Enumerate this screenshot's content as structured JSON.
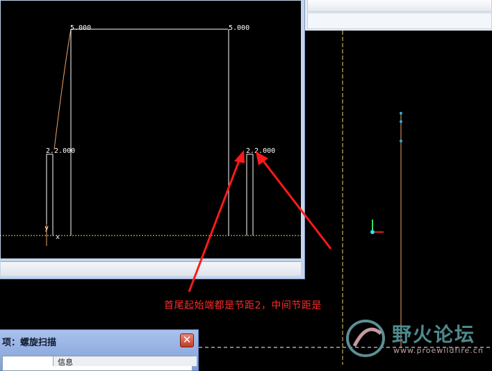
{
  "sketch": {
    "dims": {
      "top_left": "5.000",
      "top_right": "5.000",
      "mid_left": "2.2.000",
      "mid_right": "2.2.000"
    },
    "axis_y": "y",
    "axis_x": "x"
  },
  "annotation": {
    "text": "首尾起始端都是节距2，中间节距是"
  },
  "dialog": {
    "title": "项：螺旋扫描",
    "close_glyph": "✕",
    "column_header": "信息"
  },
  "watermark": {
    "text": "野火论坛",
    "url": "www.proewildfire.cn"
  },
  "colors": {
    "annotation": "#ff2a2a",
    "profile_line": "#f4a460",
    "centerline": "#e8d27c",
    "axis_green": "#30e060",
    "axis_red": "#e02020",
    "point_blue": "#3aa9d6"
  }
}
